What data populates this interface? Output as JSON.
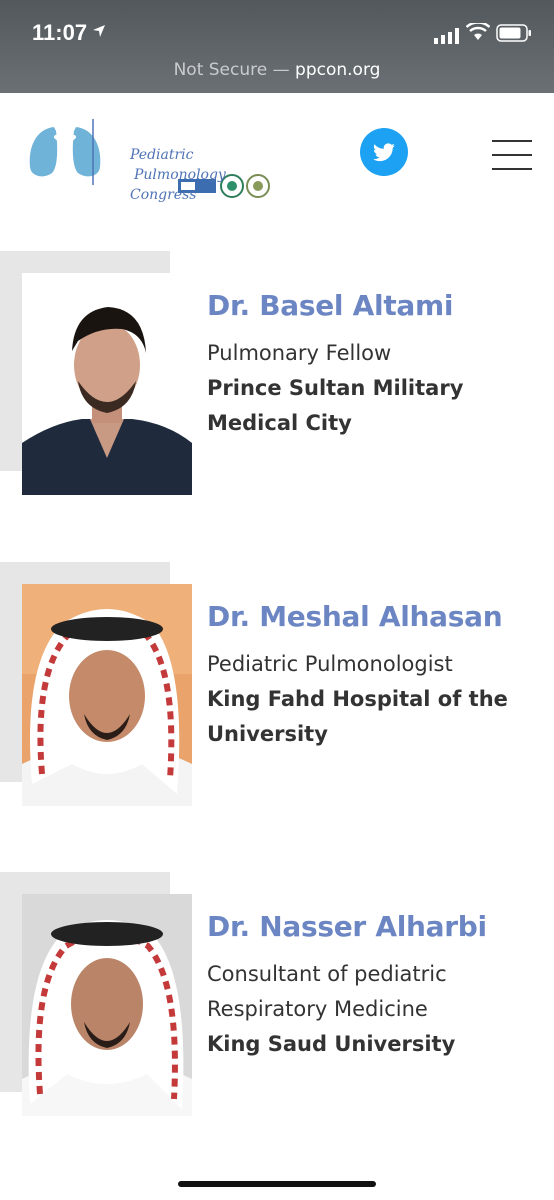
{
  "status_bar": {
    "time": "11:07"
  },
  "browser": {
    "security": "Not Secure",
    "separator": " — ",
    "domain": "ppcon.org"
  },
  "header": {
    "logo_lines": [
      "Pediatric",
      "Pulmonology",
      "Congress"
    ]
  },
  "speakers": [
    {
      "name": "Dr. Basel Altami",
      "role": "Pulmonary Fellow",
      "org": "Prince Sultan Military Medical City"
    },
    {
      "name": "Dr. Meshal Alhasan",
      "role": "Pediatric Pulmonologist",
      "org": "King Fahd Hospital of the University"
    },
    {
      "name": "Dr. Nasser Alharbi",
      "role": "Consultant of pediatric Respiratory Medicine",
      "org": "King Saud University"
    }
  ],
  "colors": {
    "accent": "#6c86c4",
    "twitter": "#1da1f2",
    "card_bg": "#e6e6e6"
  },
  "icons": [
    "location-arrow-icon",
    "signal-icon",
    "wifi-icon",
    "battery-icon",
    "twitter-icon",
    "hamburger-menu-icon"
  ]
}
